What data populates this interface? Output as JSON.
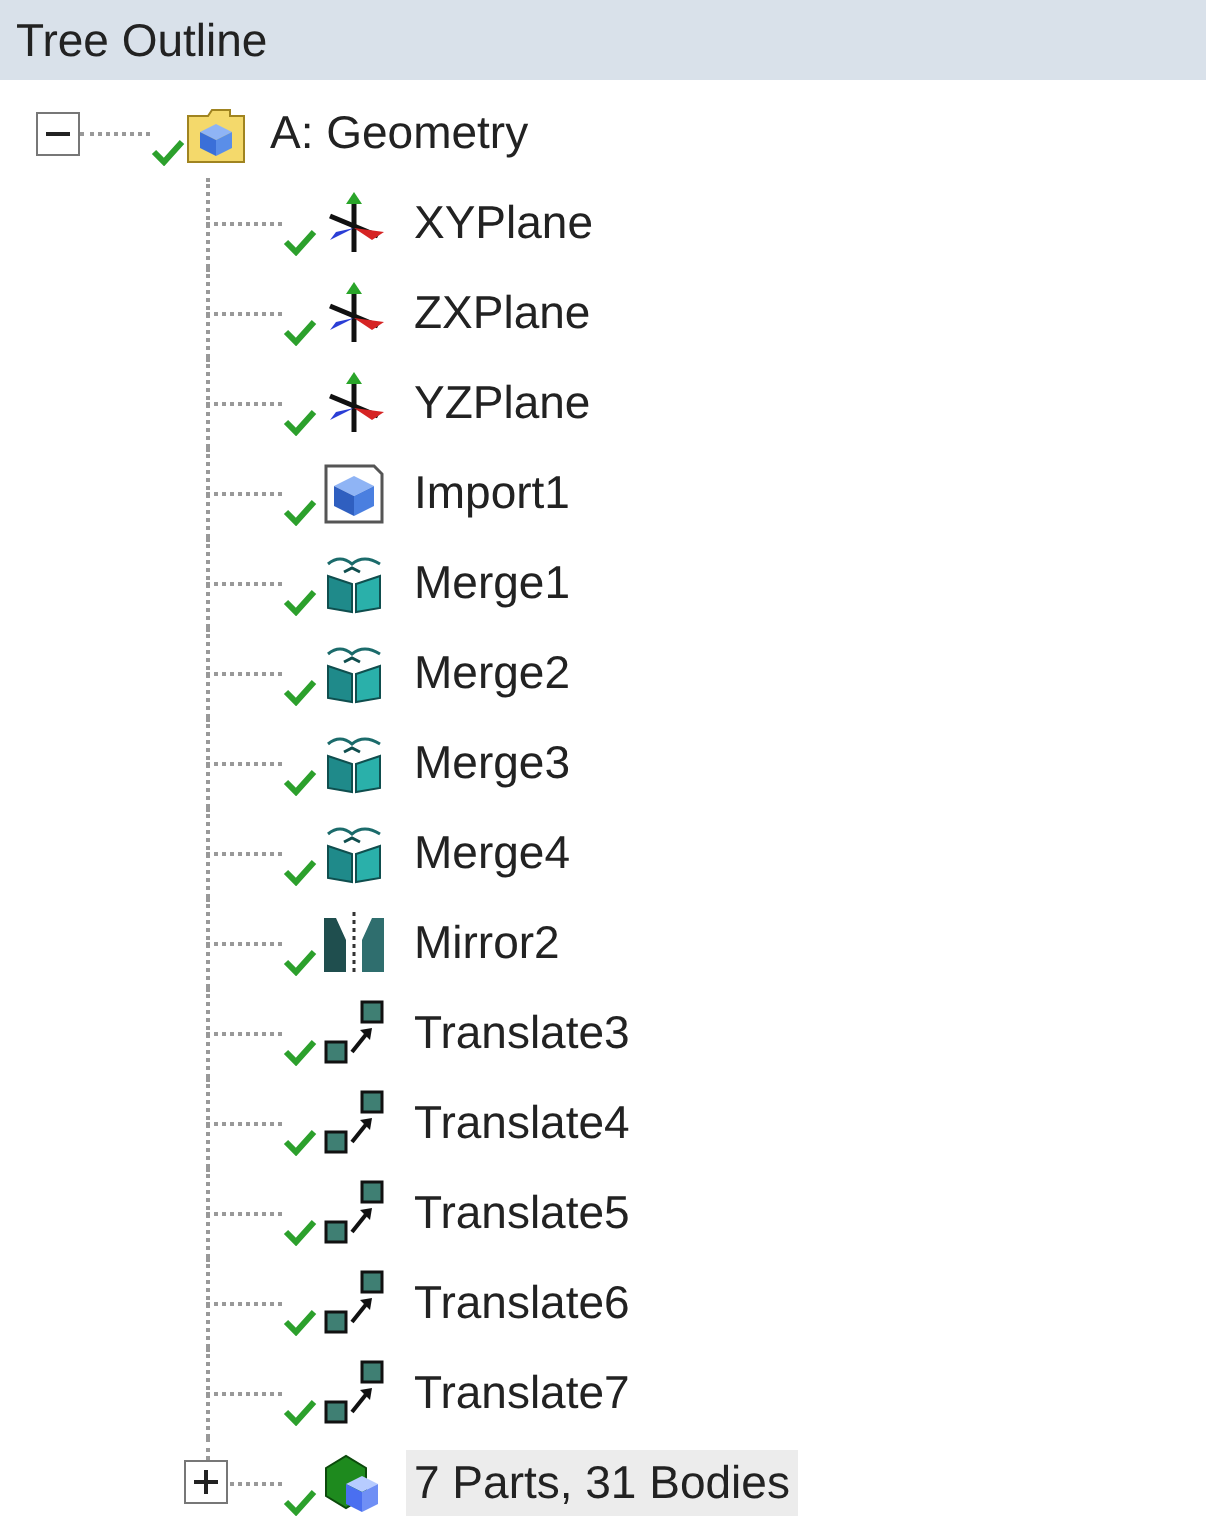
{
  "panel": {
    "title": "Tree Outline"
  },
  "tree": [
    {
      "label": "A: Geometry",
      "kind": "geometry",
      "expanded": true,
      "selected": false,
      "children": [
        {
          "label": "XYPlane",
          "kind": "plane",
          "selected": false
        },
        {
          "label": "ZXPlane",
          "kind": "plane",
          "selected": false
        },
        {
          "label": "YZPlane",
          "kind": "plane",
          "selected": false
        },
        {
          "label": "Import1",
          "kind": "import",
          "selected": false
        },
        {
          "label": "Merge1",
          "kind": "merge",
          "selected": false
        },
        {
          "label": "Merge2",
          "kind": "merge",
          "selected": false
        },
        {
          "label": "Merge3",
          "kind": "merge",
          "selected": false
        },
        {
          "label": "Merge4",
          "kind": "merge",
          "selected": false
        },
        {
          "label": "Mirror2",
          "kind": "mirror",
          "selected": false
        },
        {
          "label": "Translate3",
          "kind": "translate",
          "selected": false
        },
        {
          "label": "Translate4",
          "kind": "translate",
          "selected": false
        },
        {
          "label": "Translate5",
          "kind": "translate",
          "selected": false
        },
        {
          "label": "Translate6",
          "kind": "translate",
          "selected": false
        },
        {
          "label": "Translate7",
          "kind": "translate",
          "selected": false
        },
        {
          "label": "7 Parts, 31 Bodies",
          "kind": "parts",
          "expanded": false,
          "selected": true
        }
      ]
    }
  ]
}
